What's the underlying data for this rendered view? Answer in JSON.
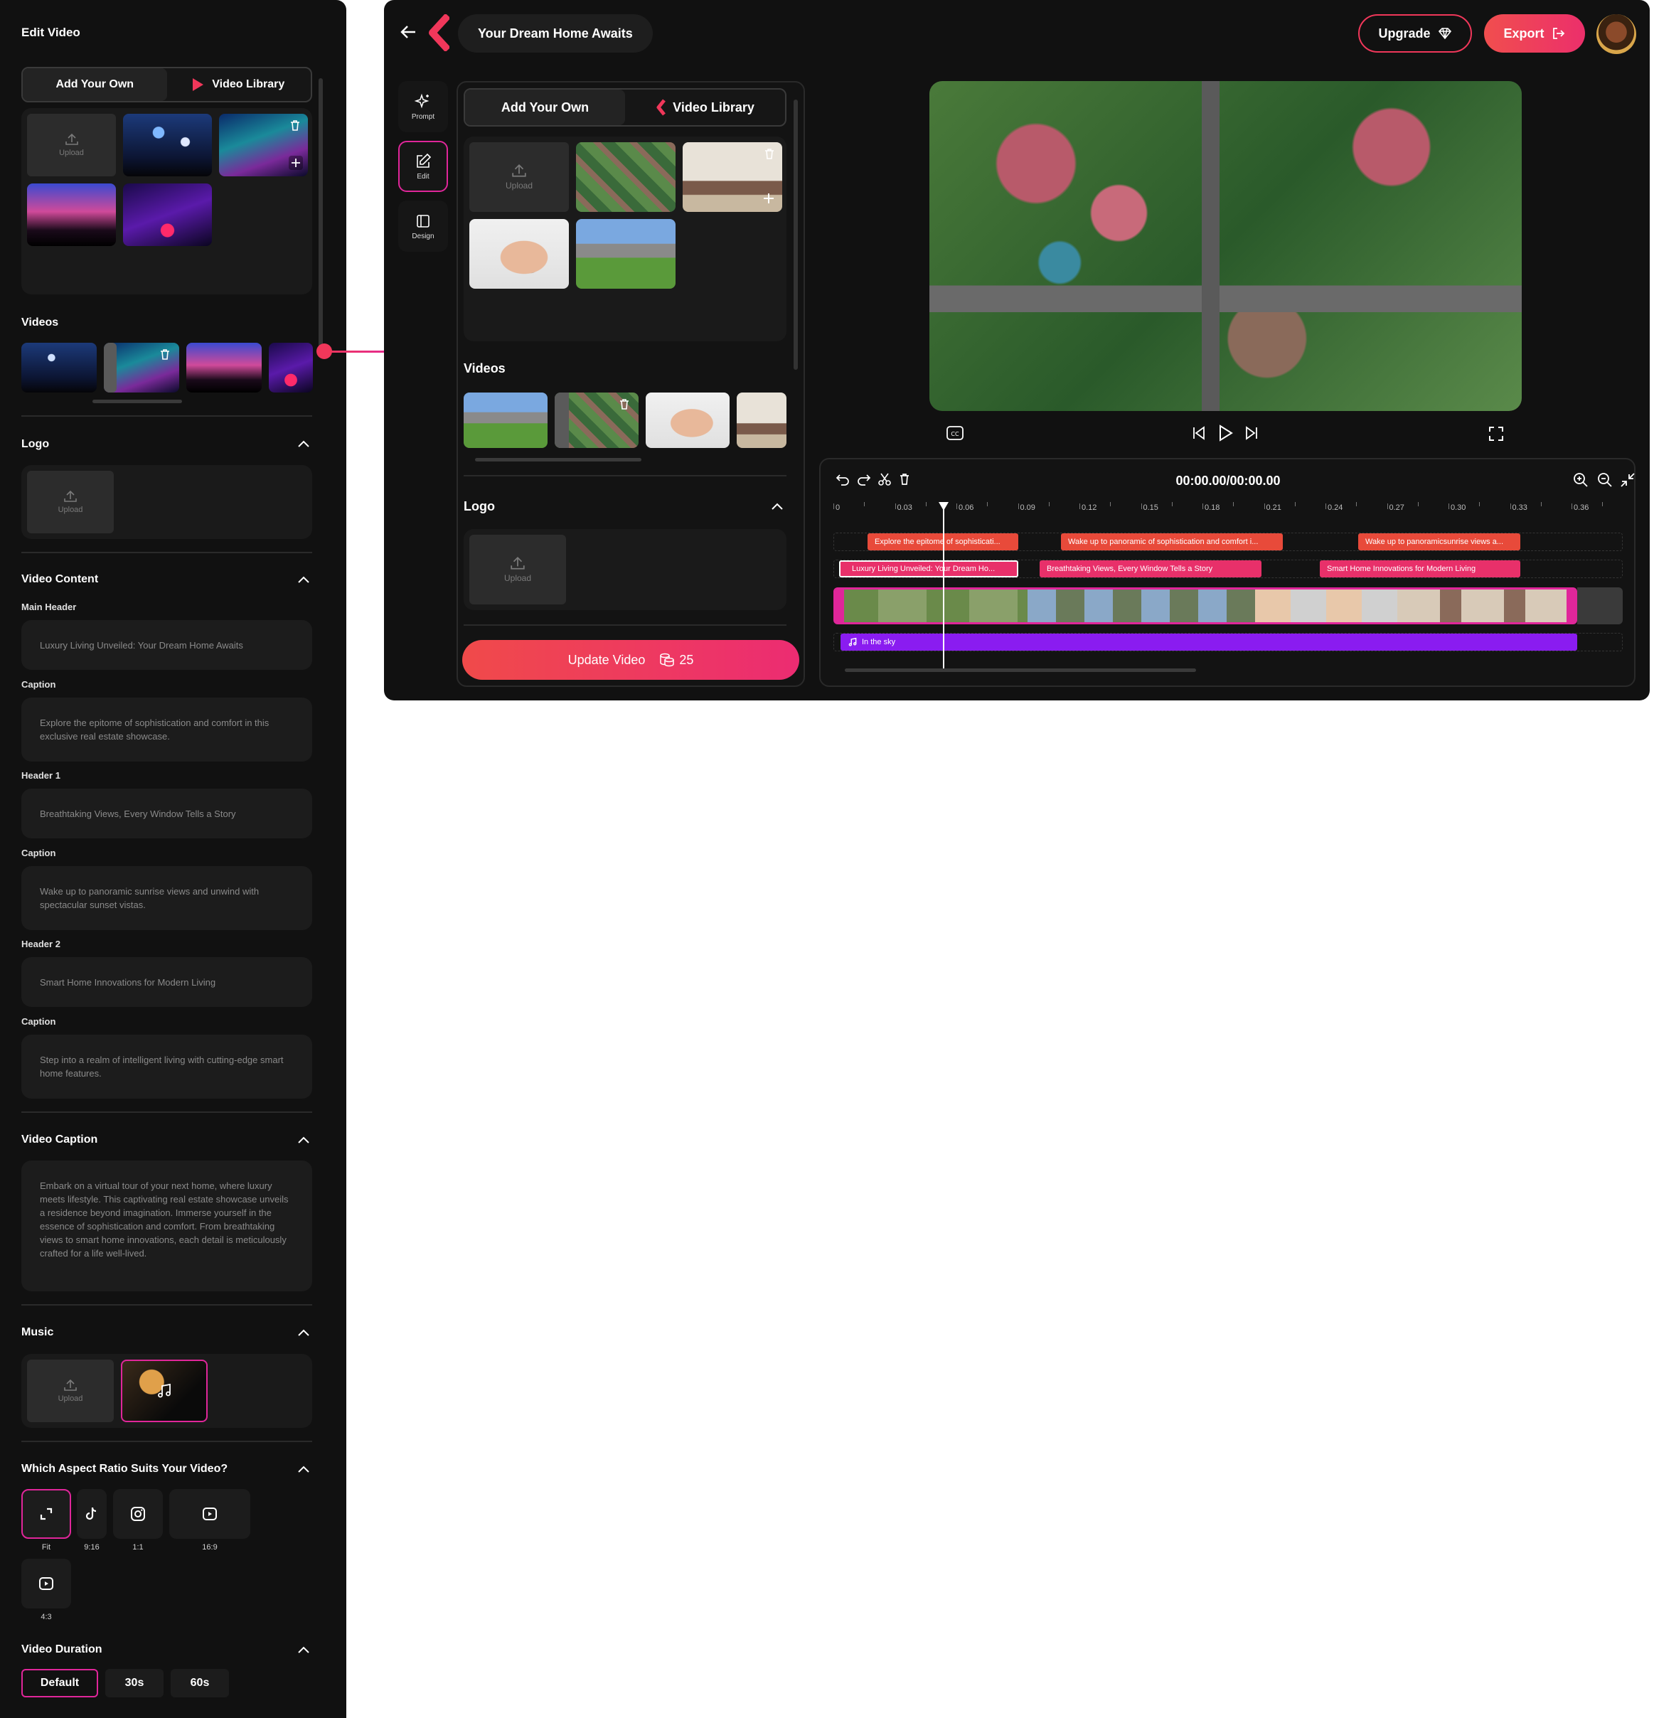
{
  "left": {
    "title": "Edit Video",
    "tabs": [
      "Add Your Own",
      "Video Library"
    ],
    "upload_label": "Upload",
    "videos_title": "Videos",
    "logo_title": "Logo",
    "content": {
      "title": "Video Content",
      "fields": [
        {
          "label": "Main Header",
          "value": "Luxury Living Unveiled: Your Dream Home Awaits"
        },
        {
          "label": "Caption",
          "value": "Explore the epitome of sophistication and comfort in this exclusive real estate showcase."
        },
        {
          "label": "Header 1",
          "value": "Breathtaking Views, Every Window Tells a Story"
        },
        {
          "label": "Caption",
          "value": "Wake up to panoramic sunrise views and unwind with spectacular sunset vistas."
        },
        {
          "label": "Header 2",
          "value": "Smart Home Innovations for Modern Living"
        },
        {
          "label": "Caption",
          "value": "Step into a realm of intelligent living with cutting-edge smart home features."
        }
      ]
    },
    "caption": {
      "title": "Video Caption",
      "value": "Embark on a virtual tour of your next home, where luxury meets lifestyle. This captivating real estate showcase unveils a residence beyond imagination. Immerse yourself in the essence of sophistication and comfort. From breathtaking views to smart home innovations, each detail is meticulously crafted for a life well-lived."
    },
    "music_title": "Music",
    "aspect": {
      "title": "Which Aspect Ratio Suits Your Video?",
      "options": [
        "Fit",
        "9:16",
        "1:1",
        "16:9",
        "4:3"
      ]
    },
    "duration": {
      "title": "Video Duration",
      "options": [
        "Default",
        "30s",
        "60s"
      ]
    }
  },
  "app": {
    "project_title": "Your Dream Home Awaits",
    "upgrade_label": "Upgrade",
    "export_label": "Export",
    "sidebar": [
      "Prompt",
      "Edit",
      "Design"
    ],
    "tabs": [
      "Add Your Own",
      "Video Library"
    ],
    "upload_label": "Upload",
    "videos_title": "Videos",
    "logo_title": "Logo",
    "update_label": "Update Video",
    "credits": "25",
    "timecode": "00:00.00/00:00.00",
    "ticks": [
      "0",
      "0.03",
      "0.06",
      "0.09",
      "0.12",
      "0.15",
      "0.18",
      "0.21",
      "0.24",
      "0.27",
      "0.30",
      "0.33",
      "0.36"
    ],
    "caption_clips": [
      "Explore the epitome of sophisticati...",
      "Wake up to panoramic of sophistication and comfort i...",
      "Wake up to panoramicsunrise views a..."
    ],
    "header_clips": [
      "Luxury Living Unveiled: Your Dream Ho...",
      "Breathtaking Views, Every Window Tells a Story",
      "Smart Home Innovations for Modern Living"
    ],
    "music_clip": "In the sky"
  },
  "colors": {
    "accent": "#f0375a",
    "magenta": "#e0269a",
    "purple": "#8a1cf0",
    "panel": "#111111"
  }
}
